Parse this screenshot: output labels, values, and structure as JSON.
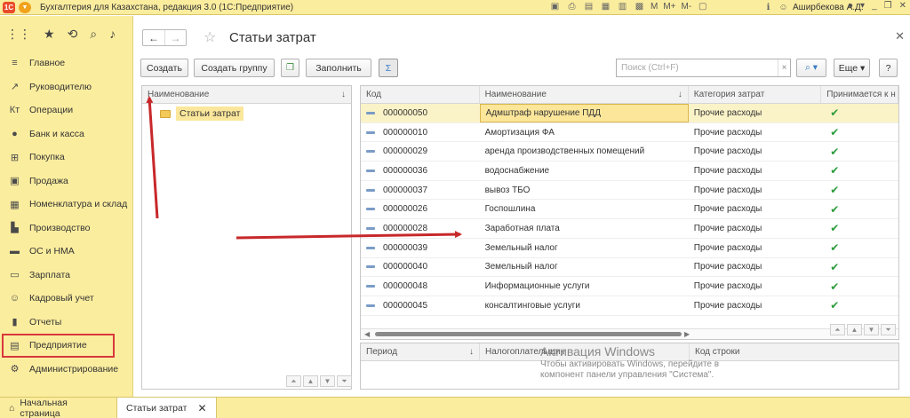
{
  "app": {
    "title": "Бухгалтерия для Казахстана, редакция 3.0  (1С:Предприятие)",
    "logo": "1С",
    "user": "Аширбекова А.Д.",
    "memory_buttons": [
      "M",
      "M+",
      "M-"
    ]
  },
  "sidebar": {
    "items": [
      {
        "label": "Главное",
        "icon": "menu-icon"
      },
      {
        "label": "Руководителю",
        "icon": "trend-icon"
      },
      {
        "label": "Операции",
        "icon": "operations-icon"
      },
      {
        "label": "Банк и касса",
        "icon": "coin-icon"
      },
      {
        "label": "Покупка",
        "icon": "cart-icon"
      },
      {
        "label": "Продажа",
        "icon": "bag-icon"
      },
      {
        "label": "Номенклатура и склад",
        "icon": "boxes-icon"
      },
      {
        "label": "Производство",
        "icon": "factory-icon"
      },
      {
        "label": "ОС и НМА",
        "icon": "truck-icon"
      },
      {
        "label": "Зарплата",
        "icon": "salary-icon"
      },
      {
        "label": "Кадровый учет",
        "icon": "person-icon"
      },
      {
        "label": "Отчеты",
        "icon": "bar-chart-icon"
      },
      {
        "label": "Предприятие",
        "icon": "building-icon"
      },
      {
        "label": "Администрирование",
        "icon": "gear-icon"
      }
    ],
    "active_index": 12
  },
  "page": {
    "title": "Статьи затрат"
  },
  "toolbar": {
    "create": "Создать",
    "create_group": "Создать группу",
    "fill": "Заполнить",
    "search_placeholder": "Поиск (Ctrl+F)",
    "more": "Еще",
    "help": "?"
  },
  "tree": {
    "header": "Наименование",
    "items": [
      "Статьи затрат"
    ]
  },
  "grid": {
    "columns": [
      "Код",
      "Наименование",
      "Категория затрат",
      "Принимается к н"
    ],
    "rows": [
      {
        "code": "000000050",
        "name": "Адмштраф нарушение ПДД",
        "category": "Прочие расходы",
        "accepted": true
      },
      {
        "code": "000000010",
        "name": "Амортизация ФА",
        "category": "Прочие расходы",
        "accepted": true
      },
      {
        "code": "000000029",
        "name": "аренда производственных помещений",
        "category": "Прочие расходы",
        "accepted": true
      },
      {
        "code": "000000036",
        "name": "водоснабжение",
        "category": "Прочие расходы",
        "accepted": true
      },
      {
        "code": "000000037",
        "name": "вывоз ТБО",
        "category": "Прочие расходы",
        "accepted": true
      },
      {
        "code": "000000026",
        "name": "Госпошлина",
        "category": "Прочие расходы",
        "accepted": true
      },
      {
        "code": "000000028",
        "name": "Заработная плата",
        "category": "Прочие расходы",
        "accepted": true
      },
      {
        "code": "000000039",
        "name": "Земельный налог",
        "category": "Прочие расходы",
        "accepted": true
      },
      {
        "code": "000000040",
        "name": "Земельный налог",
        "category": "Прочие расходы",
        "accepted": true
      },
      {
        "code": "000000048",
        "name": "Информационные услуги",
        "category": "Прочие расходы",
        "accepted": true
      },
      {
        "code": "000000045",
        "name": "консалтинговые  услуги",
        "category": "Прочие расходы",
        "accepted": true
      }
    ]
  },
  "grid2": {
    "columns": [
      "Период",
      "Налогоплательщик",
      "Код строки"
    ]
  },
  "watermark": {
    "title": "Активация Windows",
    "line1": "Чтобы активировать Windows, перейдите в",
    "line2": "компонент панели управления \"Система\"."
  },
  "tabs": {
    "home": "Начальная страница",
    "current": "Статьи затрат"
  },
  "colors": {
    "panel_yellow": "#fbed9e",
    "highlight_red": "#d8383d",
    "selection": "#fbe69a",
    "check_green": "#2a9b3a"
  }
}
